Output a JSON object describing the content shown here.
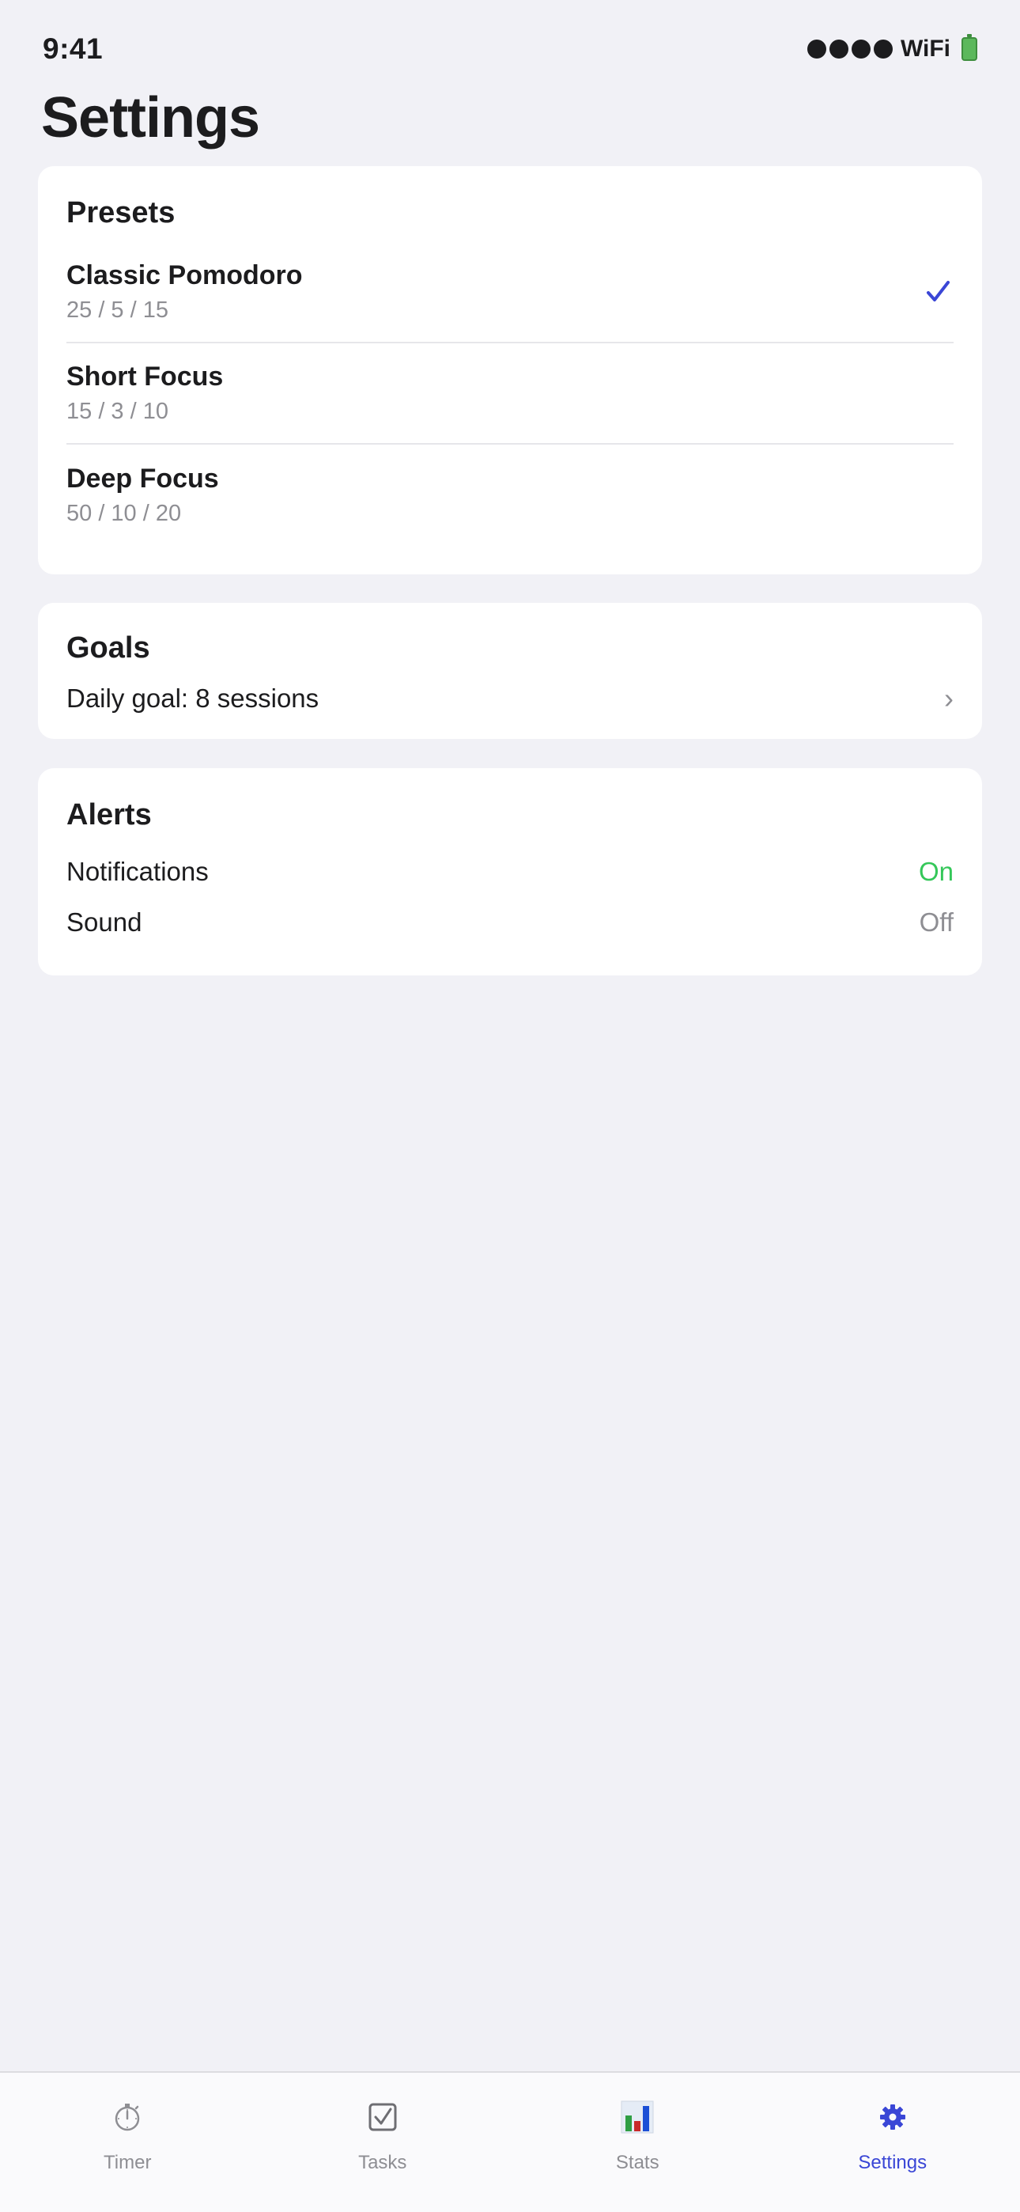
{
  "status_bar": {
    "time": "9:41",
    "network": "WiFi",
    "signal_icon": "signal-dots-icon",
    "battery_icon": "battery-icon"
  },
  "page": {
    "title": "Settings"
  },
  "presets": {
    "title": "Presets",
    "items": [
      {
        "name": "Classic Pomodoro",
        "times": "25 / 5 / 15",
        "selected": true
      },
      {
        "name": "Short Focus",
        "times": "15 / 3 / 10",
        "selected": false
      },
      {
        "name": "Deep Focus",
        "times": "50 / 10 / 20",
        "selected": false
      }
    ],
    "selected_icon": "checkmark-icon"
  },
  "goals": {
    "title": "Goals",
    "daily_goal": "Daily goal: 8 sessions",
    "chevron": "›"
  },
  "alerts": {
    "title": "Alerts",
    "items": [
      {
        "label": "Notifications",
        "value": "On"
      },
      {
        "label": "Sound",
        "value": "Off"
      }
    ]
  },
  "tab_bar": {
    "tabs": [
      {
        "label": "Timer",
        "icon": "stopwatch-icon",
        "active": false
      },
      {
        "label": "Tasks",
        "icon": "checkbox-icon",
        "active": false
      },
      {
        "label": "Stats",
        "icon": "bar-chart-icon",
        "active": false
      },
      {
        "label": "Settings",
        "icon": "gear-icon",
        "active": true
      }
    ]
  },
  "colors": {
    "accent": "#3a46d6",
    "on": "#34c759",
    "off": "#8e8e93",
    "background": "#f1f1f6",
    "card": "#ffffff"
  }
}
